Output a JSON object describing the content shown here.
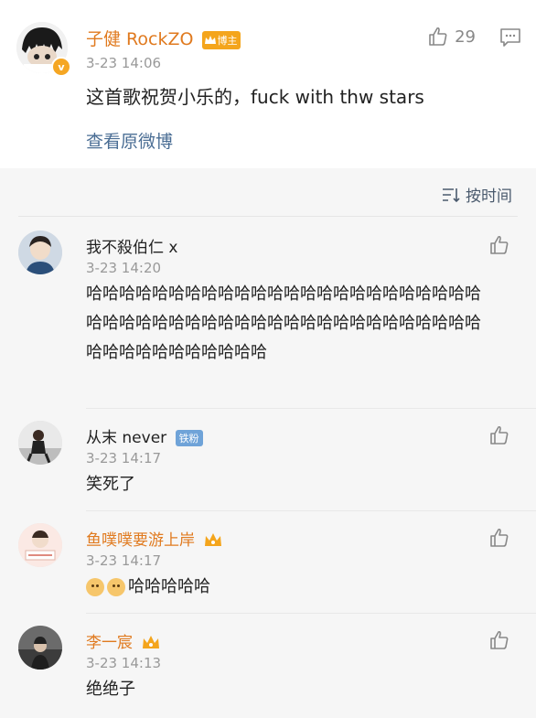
{
  "post": {
    "author": "子健 RockZO",
    "blogger_badge": "博主",
    "timestamp": "3-23 14:06",
    "text": "这首歌祝贺小乐的，fuck with thw stars",
    "like_count": "29",
    "view_original": "查看原微博"
  },
  "sort": {
    "label": "按时间"
  },
  "comments": [
    {
      "name": "我不殺伯仁 x",
      "time": "3-23 14:20",
      "text": "哈哈哈哈哈哈哈哈哈哈哈哈哈哈哈哈哈哈哈哈哈哈哈哈哈哈哈哈哈哈哈哈哈哈哈哈哈哈哈哈哈哈哈哈哈哈哈哈哈哈哈哈哈哈哈哈哈哈哈"
    },
    {
      "name": "从末 never",
      "badge": "铁粉",
      "time": "3-23 14:17",
      "text": "笑死了"
    },
    {
      "name": "鱼噗噗要游上岸",
      "time": "3-23 14:17",
      "text": "哈哈哈哈哈"
    },
    {
      "name": "李一宸",
      "time": "3-23 14:13",
      "text": "绝绝子"
    }
  ],
  "colors": {
    "accent": "#e07a1f",
    "link": "#4a6d94",
    "muted": "#999999"
  }
}
